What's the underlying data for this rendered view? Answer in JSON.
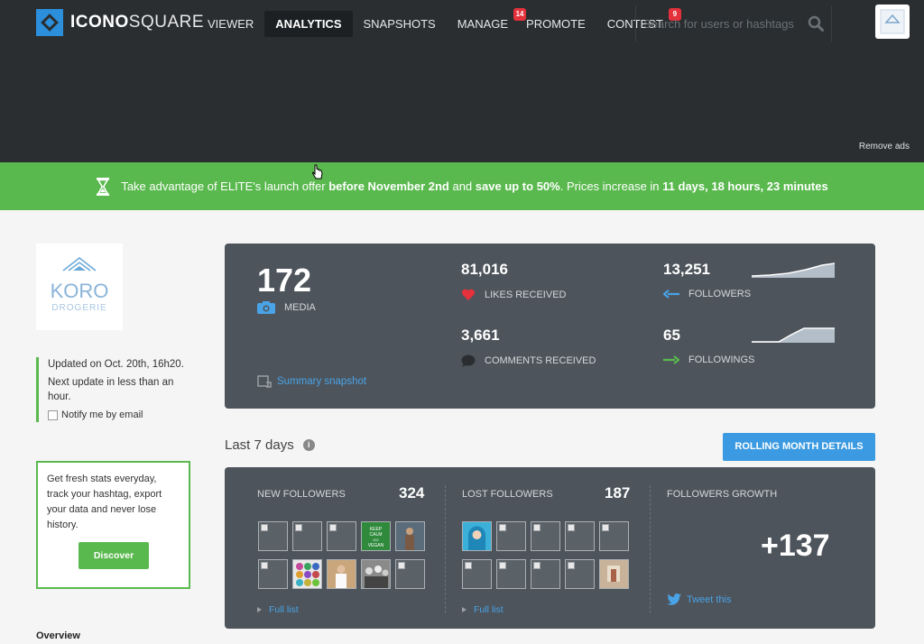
{
  "brand": {
    "name_bold": "ICONO",
    "name_light": "SQUARE"
  },
  "nav": [
    {
      "label": "VIEWER",
      "active": false
    },
    {
      "label": "ANALYTICS",
      "active": true
    },
    {
      "label": "SNAPSHOTS",
      "active": false
    },
    {
      "label": "MANAGE",
      "active": false,
      "badge": "14"
    },
    {
      "label": "PROMOTE",
      "active": false
    },
    {
      "label": "CONTEST",
      "active": false,
      "badge": "9"
    }
  ],
  "search": {
    "placeholder": "Search for users or hashtags"
  },
  "remove_ads": "Remove ads",
  "promo": {
    "t1": "Take advantage of ELITE's launch offer ",
    "b1": "before November 2nd",
    "t2": " and ",
    "b2": "save up to 50%",
    "t3": ". Prices increase in ",
    "b3": "11 days, 18 hours, 23 minutes"
  },
  "sidebar": {
    "brand_logo_line1": "KORO",
    "brand_logo_line2": "DROGERIE",
    "updated": "Updated on Oct. 20th, 16h20.",
    "next_update": "Next update in less than an hour.",
    "notify": "Notify me by email",
    "cta_text": "Get fresh stats everyday, track your hashtag, export your data and never lose history.",
    "discover": "Discover",
    "overview": "Overview"
  },
  "stats": {
    "media_count": "172",
    "media_label": "MEDIA",
    "likes_count": "81,016",
    "likes_label": "LIKES RECEIVED",
    "comments_count": "3,661",
    "comments_label": "COMMENTS RECEIVED",
    "followers_count": "13,251",
    "followers_label": "FOLLOWERS",
    "followings_count": "65",
    "followings_label": "FOLLOWINGS",
    "summary_link": "Summary snapshot"
  },
  "week": {
    "title": "Last 7 days",
    "rolling_btn": "ROLLING MONTH DETAILS",
    "new_followers_label": "NEW FOLLOWERS",
    "new_followers_count": "324",
    "lost_followers_label": "LOST FOLLOWERS",
    "lost_followers_count": "187",
    "growth_label": "FOLLOWERS GROWTH",
    "growth_value": "+137",
    "full_list": "Full list",
    "tweet": "Tweet this",
    "new_thumb_row1": [
      "broken",
      "broken",
      "broken",
      "keep-calm",
      "person-dark"
    ],
    "new_thumb_row2": [
      "broken",
      "pattern",
      "person-white",
      "group-bw",
      "broken"
    ],
    "lost_thumb_row1": [
      "person-hijab",
      "broken",
      "broken",
      "broken",
      "broken"
    ],
    "lost_thumb_row2": [
      "broken",
      "broken",
      "broken",
      "broken",
      "room"
    ],
    "keep_calm_text": "KEEP CALM GO VEGAN"
  },
  "colors": {
    "nav_bg": "#2a2e31",
    "promo_green": "#5ab94e",
    "panel_bg": "#4d545b",
    "link_blue": "#4aa3e6",
    "button_blue": "#3b9ae1",
    "badge_red": "#e5313b",
    "heart_red": "#e5313b"
  }
}
